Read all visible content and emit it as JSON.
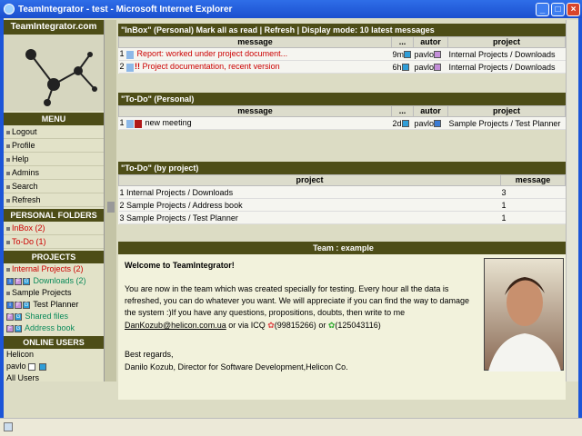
{
  "window": {
    "title": "TeamIntegrator - test - Microsoft Internet Explorer"
  },
  "sidebar": {
    "brand": "TeamIntegrator.com",
    "menu_title": "MENU",
    "menu": [
      "Logout",
      "Profile",
      "Help",
      "Admins",
      "Search",
      "Refresh"
    ],
    "personal_title": "PERSONAL FOLDERS",
    "personal": [
      "InBox (2)",
      "To-Do (1)"
    ],
    "projects_title": "PROJECTS",
    "projects": [
      {
        "name": "Internal Projects (2)",
        "sub": "Downloads (2)"
      },
      {
        "name": "Sample Projects",
        "subs": [
          "Test Planner",
          "Shared files",
          "Address book"
        ]
      }
    ],
    "online_title": "ONLINE USERS",
    "online": [
      "Helicon",
      "pavlo",
      "All Users"
    ]
  },
  "inbox": {
    "header": "\"InBox\" (Personal)   Mark all as read | Refresh | Display mode: 10 latest messages",
    "cols": [
      "message",
      "...",
      "autor",
      "project"
    ],
    "rows": [
      {
        "n": "1",
        "msg": "Report: worked under project document...",
        "age": "9m",
        "autor": "pavlo",
        "project": "Internal Projects / Downloads"
      },
      {
        "n": "2",
        "msg": "Project documentation, recent version",
        "age": "6h",
        "autor": "pavlo",
        "project": "Internal Projects / Downloads"
      }
    ]
  },
  "todo": {
    "header": "\"To-Do\" (Personal)",
    "cols": [
      "message",
      "...",
      "autor",
      "project"
    ],
    "rows": [
      {
        "n": "1",
        "msg": "new meeting",
        "age": "2d",
        "autor": "pavlo",
        "project": "Sample Projects / Test Planner"
      }
    ]
  },
  "todoproj": {
    "header": "\"To-Do\" (by project)",
    "cols": [
      "project",
      "message"
    ],
    "rows": [
      {
        "project": "1 Internal Projects / Downloads",
        "count": "3"
      },
      {
        "project": "2 Sample Projects / Address book",
        "count": "1"
      },
      {
        "project": "3 Sample Projects / Test Planner",
        "count": "1"
      }
    ]
  },
  "team": {
    "header": "Team : example",
    "welcome": "Welcome to TeamIntegrator!",
    "body": "You are now in the team which was created specially for testing. Every hour all the data is refreshed, you can do whatever you want. We will appreciate if you can find the way to damage the system :)If you have any questions, propositions, doubts, then write to me",
    "email": "DanKozub@helicon.com.ua",
    "icq_text": " or via ICQ ",
    "icq1": "(99815266)",
    "or": " or ",
    "icq2": "(125043116)",
    "regards": "Best regards,",
    "signature": "Danilo Kozub, Director for Software Development,Helicon Co."
  }
}
